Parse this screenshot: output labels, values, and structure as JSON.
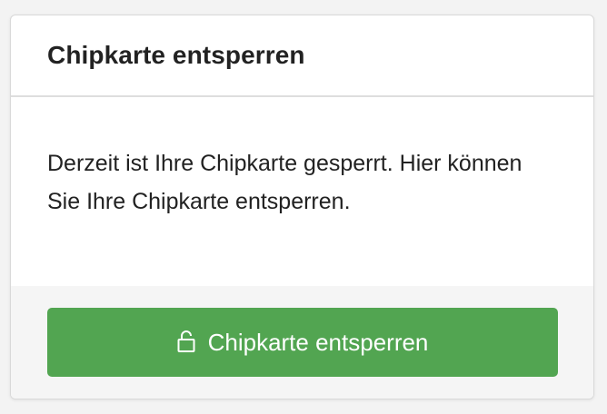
{
  "card": {
    "title": "Chipkarte entsperren",
    "text": "Derzeit ist Ihre Chipkarte gesperrt. Hier können Sie Ihre Chipkarte entsperren."
  },
  "footer": {
    "button_label": "Chipkarte entsperren",
    "button_icon": "unlock-icon",
    "button_color": "#52a551"
  }
}
